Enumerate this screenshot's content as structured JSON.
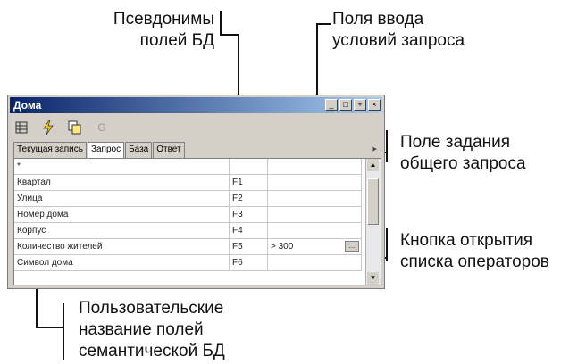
{
  "callouts": {
    "aliases": "Псевдонимы\nполей БД",
    "query_inputs": "Поля ввода\nусловий запроса",
    "general_query": "Поле задания\nобщего запроса",
    "operator_button": "Кнопка открытия\nсписка операторов",
    "semantic_names": "Пользовательские\nназвание полей\nсемантической БД"
  },
  "window": {
    "title": "Дома",
    "controls": [
      "_",
      "□",
      "+",
      "×"
    ]
  },
  "toolbar": {
    "icons": [
      "grid-icon",
      "lightning-icon",
      "copy-icon",
      "g-icon"
    ],
    "g_label": "G"
  },
  "tabs": [
    {
      "label": "Текущая запись",
      "active": false
    },
    {
      "label": "Запрос",
      "active": true
    },
    {
      "label": "База",
      "active": false
    },
    {
      "label": "Ответ",
      "active": false
    }
  ],
  "rows": [
    {
      "name": "*",
      "alias": "",
      "value": ""
    },
    {
      "name": "Квартал",
      "alias": "F1",
      "value": ""
    },
    {
      "name": "Улица",
      "alias": "F2",
      "value": ""
    },
    {
      "name": "Номер дома",
      "alias": "F3",
      "value": ""
    },
    {
      "name": "Корпус",
      "alias": "F4",
      "value": ""
    },
    {
      "name": "Количество жителей",
      "alias": "F5",
      "value": "> 300"
    },
    {
      "name": "Символ дома",
      "alias": "F6",
      "value": ""
    }
  ],
  "operator_button_label": "..."
}
